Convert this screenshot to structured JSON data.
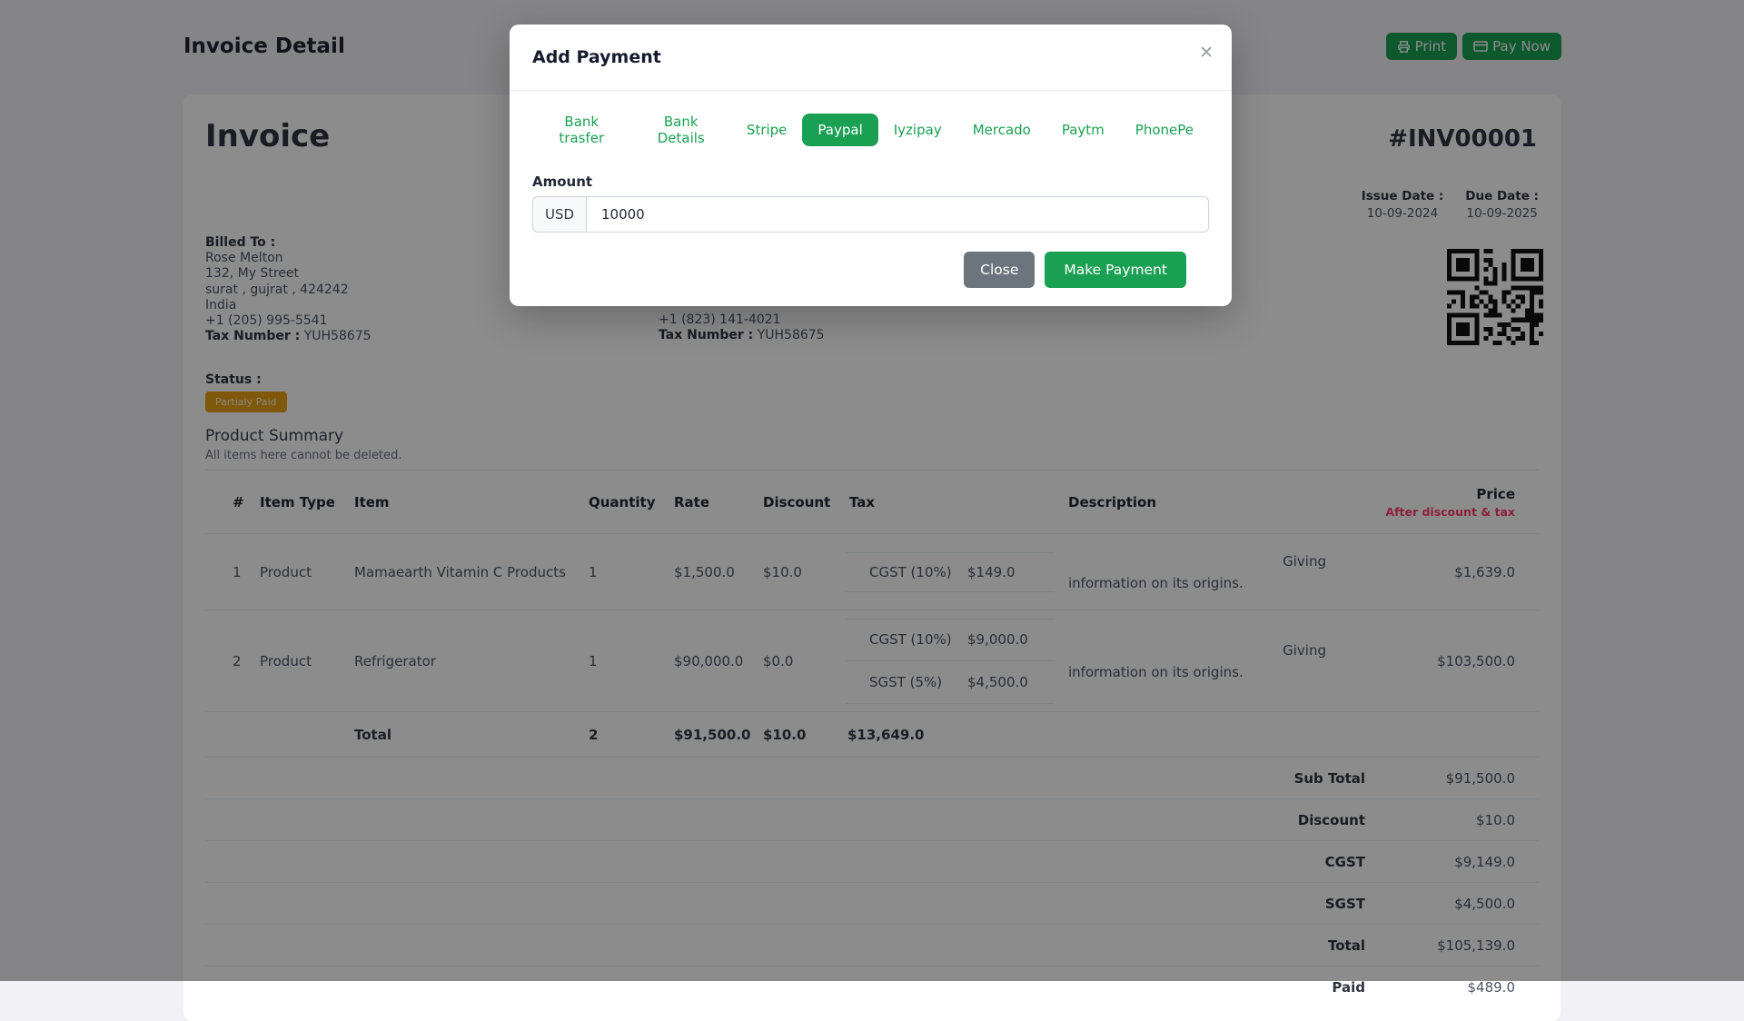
{
  "page": {
    "title": "Invoice Detail",
    "toolbar": {
      "print_label": "Print",
      "pay_now_label": "Pay Now"
    }
  },
  "invoice": {
    "heading": "Invoice",
    "number": "#INV00001",
    "issue_date_label": "Issue Date :",
    "issue_date": "10-09-2024",
    "due_date_label": "Due Date :",
    "due_date": "10-09-2025",
    "billed_to": {
      "label": "Billed To :",
      "name": "Rose Melton",
      "street": "132, My Street",
      "city": "surat , gujrat , 424242",
      "country": "India",
      "phone": "+1 (205) 995-5541",
      "tax_label": "Tax Number :",
      "tax_number": "YUH58675"
    },
    "shipped_to_visible": {
      "phone": "+1 (823) 141-4021",
      "tax_label": "Tax Number :",
      "tax_number": "YUH58675"
    },
    "status_label": "Status :",
    "status_badge": "Partialy Paid"
  },
  "product_summary": {
    "title": "Product Summary",
    "subtitle": "All items here cannot be deleted.",
    "columns": {
      "index": "#",
      "item_type": "Item Type",
      "item": "Item",
      "quantity": "Quantity",
      "rate": "Rate",
      "discount": "Discount",
      "tax": "Tax",
      "description": "Description",
      "price": "Price",
      "price_sub": "After discount & tax"
    },
    "rows": [
      {
        "index": "1",
        "item_type": "Product",
        "item": "Mamaearth Vitamin C Products",
        "quantity": "1",
        "rate": "$1,500.0",
        "discount": "$10.0",
        "taxes": [
          {
            "name": "CGST (10%)",
            "amount": "$149.0"
          }
        ],
        "description_lines": [
          "Giving",
          "information on its origins."
        ],
        "price": "$1,639.0"
      },
      {
        "index": "2",
        "item_type": "Product",
        "item": "Refrigerator",
        "quantity": "1",
        "rate": "$90,000.0",
        "discount": "$0.0",
        "taxes": [
          {
            "name": "CGST (10%)",
            "amount": "$9,000.0"
          },
          {
            "name": "SGST (5%)",
            "amount": "$4,500.0"
          }
        ],
        "description_lines": [
          "Giving",
          "information on its origins."
        ],
        "price": "$103,500.0"
      }
    ],
    "total_row": {
      "label": "Total",
      "quantity": "2",
      "rate": "$91,500.0",
      "discount": "$10.0",
      "tax": "$13,649.0"
    },
    "totals": [
      {
        "label": "Sub Total",
        "value": "$91,500.0"
      },
      {
        "label": "Discount",
        "value": "$10.0"
      },
      {
        "label": "CGST",
        "value": "$9,149.0"
      },
      {
        "label": "SGST",
        "value": "$4,500.0"
      },
      {
        "label": "Total",
        "value": "$105,139.0"
      },
      {
        "label": "Paid",
        "value": "$489.0"
      }
    ]
  },
  "modal": {
    "title": "Add Payment",
    "close_glyph": "✕",
    "tabs": [
      {
        "label": "Bank trasfer"
      },
      {
        "label": "Bank Details"
      },
      {
        "label": "Stripe"
      },
      {
        "label": "Paypal"
      },
      {
        "label": "Iyzipay"
      },
      {
        "label": "Mercado"
      },
      {
        "label": "Paytm"
      },
      {
        "label": "PhonePe"
      }
    ],
    "amount_label": "Amount",
    "currency": "USD",
    "amount_value": "10000",
    "close_button": "Close",
    "submit_button": "Make Payment"
  },
  "colors": {
    "accent_green": "#1aa053",
    "danger_red": "#ff3a6e",
    "warning_badge": "#e9a117",
    "gray_button": "#6c757d"
  }
}
